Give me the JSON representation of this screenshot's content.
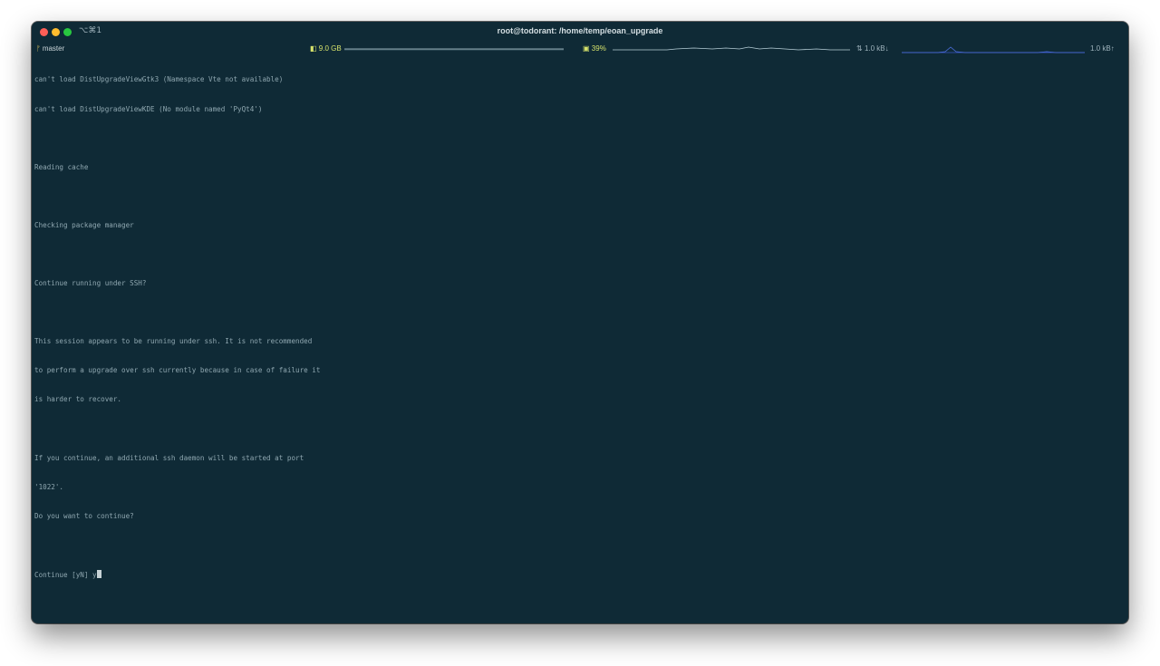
{
  "window": {
    "shortcut": "⌥⌘1",
    "title": "root@todorant: /home/temp/eoan_upgrade"
  },
  "statusbar": {
    "branch_icon": "git-branch-icon",
    "branch": "master",
    "memory": "9.0 GB",
    "cpu": "39%",
    "net_down": "1.0 kB↓",
    "net_up": "1.0 kB↑"
  },
  "terminal": {
    "lines": [
      "can't load DistUpgradeViewGtk3 (Namespace Vte not available)",
      "can't load DistUpgradeViewKDE (No module named 'PyQt4')",
      "",
      "Reading cache",
      "",
      "Checking package manager",
      "",
      "Continue running under SSH?",
      "",
      "This session appears to be running under ssh. It is not recommended",
      "to perform a upgrade over ssh currently because in case of failure it",
      "is harder to recover.",
      "",
      "If you continue, an additional ssh daemon will be started at port",
      "'1022'.",
      "Do you want to continue?",
      "",
      "Continue [yN] y"
    ]
  },
  "colors": {
    "background": "#0f2a36",
    "text": "#8fa7b0",
    "accent": "#d6e26b",
    "graph_line": "#3a57c9"
  }
}
